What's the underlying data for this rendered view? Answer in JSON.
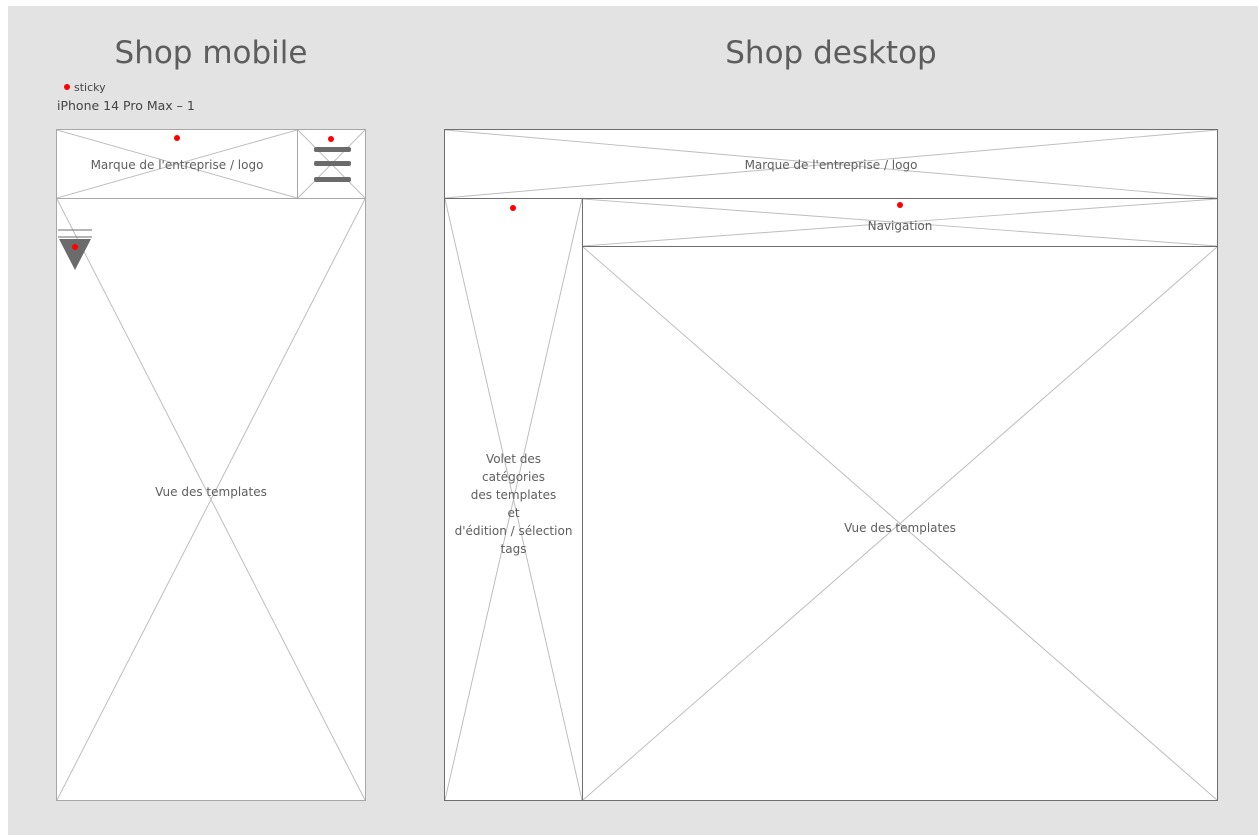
{
  "mobile": {
    "title": "Shop mobile",
    "legend_label": "sticky",
    "device_label": "iPhone 14 Pro Max – 1",
    "header_logo_text": "Marque de l'entreprise / logo",
    "templates_view_text": "Vue des templates",
    "menu_icon": "hamburger-menu-icon",
    "dropdown_icon": "triangle-down-icon"
  },
  "desktop": {
    "title": "Shop desktop",
    "header_logo_text": "Marque de l'entreprise / logo",
    "navigation_text": "Navigation",
    "sidebar_lines": [
      "Volet des",
      "catégories",
      "des templates",
      "et",
      "d'édition / sélection",
      "tags"
    ],
    "templates_view_text": "Vue des templates"
  },
  "colors": {
    "background": "#e3e3e3",
    "sticky_marker": "#ff0000",
    "placeholder_stroke": "#bdbdbd"
  }
}
